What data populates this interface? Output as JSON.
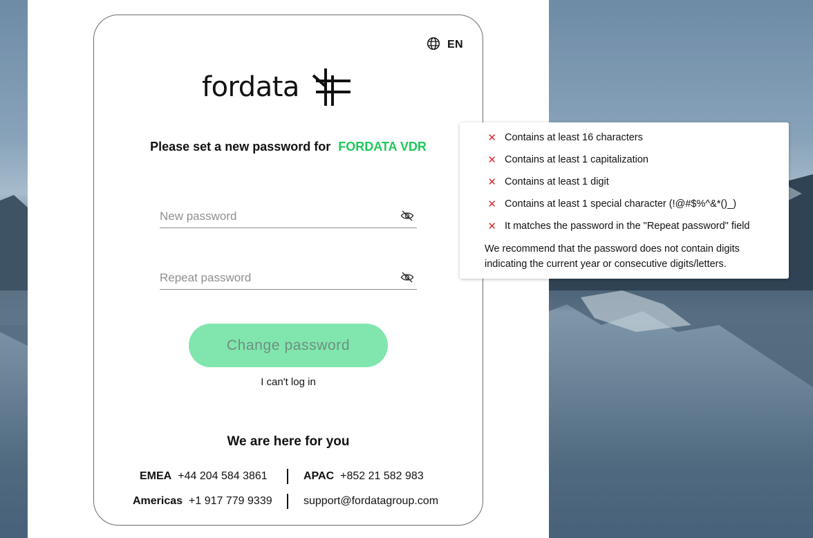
{
  "language": {
    "code": "EN",
    "icon": "globe-icon"
  },
  "logo": {
    "wordmark": "fordata"
  },
  "heading": {
    "text": "Please set a new password for",
    "brand": "FORDATA VDR"
  },
  "form": {
    "new_password_placeholder": "New password",
    "repeat_password_placeholder": "Repeat password",
    "toggle_icon": "eye-off-icon",
    "submit_label": "Change password",
    "cant_login": "I can't log in"
  },
  "support": {
    "title": "We are here for you",
    "contacts": [
      {
        "region": "EMEA",
        "value": "+44 204 584 3861"
      },
      {
        "region": "APAC",
        "value": "+852 21 582 983"
      },
      {
        "region": "Americas",
        "value": "+1 917 779 9339"
      },
      {
        "region": "",
        "value": "support@fordatagroup.com"
      }
    ]
  },
  "requirements": {
    "status_icon": "x-icon",
    "rules": [
      "Contains at least 16 characters",
      "Contains at least 1 capitalization",
      "Contains at least 1 digit",
      "Contains at least 1 special character (!@#$%^&*()_)",
      "It matches the password in the \"Repeat password\" field"
    ],
    "recommendation": "We recommend that the password does not contain digits indicating the current year or consecutive digits/letters."
  },
  "colors": {
    "brand_green": "#1fc95c",
    "button_bg": "#80e6ad",
    "error_red": "#e02b2b"
  }
}
